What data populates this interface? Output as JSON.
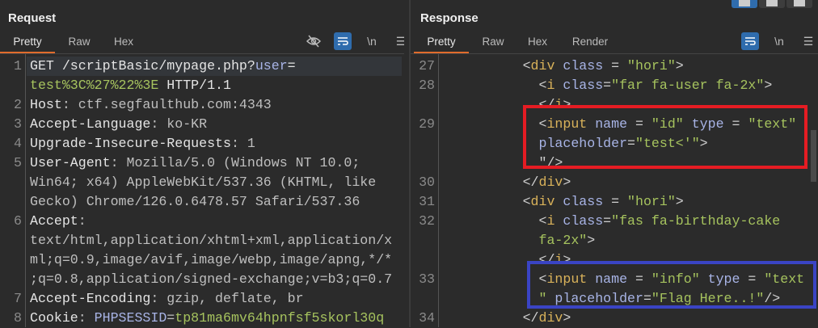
{
  "request": {
    "title": "Request",
    "tabs": [
      "Pretty",
      "Raw",
      "Hex"
    ],
    "active_tab": "Pretty",
    "tool_icons": {
      "hide": "eye-slash-icon",
      "wrap": "wrap-icon",
      "newline": "\\n",
      "menu": "☰"
    },
    "lines": [
      {
        "n": "1",
        "segs": [
          [
            "GET /scriptBasic/mypage.php?",
            "w"
          ],
          [
            "user",
            "a"
          ],
          [
            "=",
            "w"
          ]
        ]
      },
      {
        "n": "",
        "segs": [
          [
            "test%3C%27%22%3E",
            "v"
          ],
          [
            " HTTP/1.1",
            "w"
          ]
        ]
      },
      {
        "n": "2",
        "segs": [
          [
            "Host",
            "w"
          ],
          [
            ": ctf.segfaulthub.com:4343",
            "g"
          ]
        ]
      },
      {
        "n": "3",
        "segs": [
          [
            "Accept-Language",
            "w"
          ],
          [
            ": ko-KR",
            "g"
          ]
        ]
      },
      {
        "n": "4",
        "segs": [
          [
            "Upgrade-Insecure-Requests",
            "w"
          ],
          [
            ": 1",
            "g"
          ]
        ]
      },
      {
        "n": "5",
        "segs": [
          [
            "User-Agent",
            "w"
          ],
          [
            ": Mozilla/5.0 (Windows NT 10.0;",
            "g"
          ]
        ]
      },
      {
        "n": "",
        "segs": [
          [
            "Win64; x64) AppleWebKit/537.36 (KHTML, like",
            "g"
          ]
        ]
      },
      {
        "n": "",
        "segs": [
          [
            "Gecko) Chrome/126.0.6478.57 Safari/537.36",
            "g"
          ]
        ]
      },
      {
        "n": "6",
        "segs": [
          [
            "Accept",
            "w"
          ],
          [
            ":",
            "g"
          ]
        ]
      },
      {
        "n": "",
        "segs": [
          [
            "text/html,application/xhtml+xml,application/x",
            "g"
          ]
        ]
      },
      {
        "n": "",
        "segs": [
          [
            "ml;q=0.9,image/avif,image/webp,image/apng,*/*",
            "g"
          ]
        ]
      },
      {
        "n": "",
        "segs": [
          [
            ";q=0.8,application/signed-exchange;v=b3;q=0.7",
            "g"
          ]
        ]
      },
      {
        "n": "7",
        "segs": [
          [
            "Accept-Encoding",
            "w"
          ],
          [
            ": gzip, deflate, br",
            "g"
          ]
        ]
      },
      {
        "n": "8",
        "segs": [
          [
            "Cookie",
            "w"
          ],
          [
            ": ",
            "g"
          ],
          [
            "PHPSESSID",
            "a"
          ],
          [
            "=",
            "g"
          ],
          [
            "tp81ma6mv64hpnfsf5skorl30q",
            "v"
          ]
        ]
      }
    ]
  },
  "response": {
    "title": "Response",
    "tabs": [
      "Pretty",
      "Raw",
      "Hex",
      "Render"
    ],
    "active_tab": "Pretty",
    "tool_icons": {
      "wrap": "wrap-icon",
      "newline": "\\n",
      "menu": "☰"
    },
    "lines": [
      {
        "n": "27",
        "segs": [
          [
            "          <",
            "p"
          ],
          [
            "div",
            "t"
          ],
          [
            " class",
            "a"
          ],
          [
            " = ",
            "p"
          ],
          [
            "\"hori\"",
            "v"
          ],
          [
            ">",
            "p"
          ]
        ]
      },
      {
        "n": "28",
        "segs": [
          [
            "            <",
            "p"
          ],
          [
            "i",
            "t"
          ],
          [
            " class",
            "a"
          ],
          [
            "=",
            "p"
          ],
          [
            "\"far fa-user fa-2x\"",
            "v"
          ],
          [
            ">",
            "p"
          ]
        ]
      },
      {
        "n": "",
        "segs": [
          [
            "            </",
            "p"
          ],
          [
            "i",
            "t"
          ],
          [
            ">",
            "p"
          ]
        ]
      },
      {
        "n": "29",
        "segs": [
          [
            "            <",
            "p"
          ],
          [
            "input",
            "t"
          ],
          [
            " name",
            "a"
          ],
          [
            " = ",
            "p"
          ],
          [
            "\"id\"",
            "v"
          ],
          [
            " type",
            "a"
          ],
          [
            " = ",
            "p"
          ],
          [
            "\"text\"",
            "v"
          ]
        ]
      },
      {
        "n": "",
        "segs": [
          [
            "            placeholder",
            "a"
          ],
          [
            "=",
            "p"
          ],
          [
            "\"test<'\"",
            "v"
          ],
          [
            ">",
            "p"
          ]
        ]
      },
      {
        "n": "",
        "segs": [
          [
            "            \"/>",
            "p"
          ]
        ]
      },
      {
        "n": "30",
        "segs": [
          [
            "          </",
            "p"
          ],
          [
            "div",
            "t"
          ],
          [
            ">",
            "p"
          ]
        ]
      },
      {
        "n": "31",
        "segs": [
          [
            "          <",
            "p"
          ],
          [
            "div",
            "t"
          ],
          [
            " class",
            "a"
          ],
          [
            " = ",
            "p"
          ],
          [
            "\"hori\"",
            "v"
          ],
          [
            ">",
            "p"
          ]
        ]
      },
      {
        "n": "32",
        "segs": [
          [
            "            <",
            "p"
          ],
          [
            "i",
            "t"
          ],
          [
            " class",
            "a"
          ],
          [
            "=",
            "p"
          ],
          [
            "\"fas fa-birthday-cake",
            "v"
          ]
        ]
      },
      {
        "n": "",
        "segs": [
          [
            "            fa-2x\"",
            "v"
          ],
          [
            ">",
            "p"
          ]
        ]
      },
      {
        "n": "",
        "segs": [
          [
            "            </",
            "p"
          ],
          [
            "i",
            "t"
          ],
          [
            ">",
            "p"
          ]
        ]
      },
      {
        "n": "33",
        "segs": [
          [
            "            <",
            "p"
          ],
          [
            "input",
            "t"
          ],
          [
            " name",
            "a"
          ],
          [
            " = ",
            "p"
          ],
          [
            "\"info\"",
            "v"
          ],
          [
            " type",
            "a"
          ],
          [
            " = ",
            "p"
          ],
          [
            "\"text",
            "v"
          ]
        ]
      },
      {
        "n": "",
        "segs": [
          [
            "            \"",
            "v"
          ],
          [
            " placeholder",
            "a"
          ],
          [
            "=",
            "p"
          ],
          [
            "\"Flag Here..!\"",
            "v"
          ],
          [
            "/>",
            "p"
          ]
        ]
      },
      {
        "n": "34",
        "segs": [
          [
            "          </",
            "p"
          ],
          [
            "div",
            "t"
          ],
          [
            ">",
            "p"
          ]
        ]
      }
    ]
  },
  "highlights": {
    "red": "#e51c23",
    "blue": "#3a44c4"
  },
  "accent": "#e06c2c"
}
